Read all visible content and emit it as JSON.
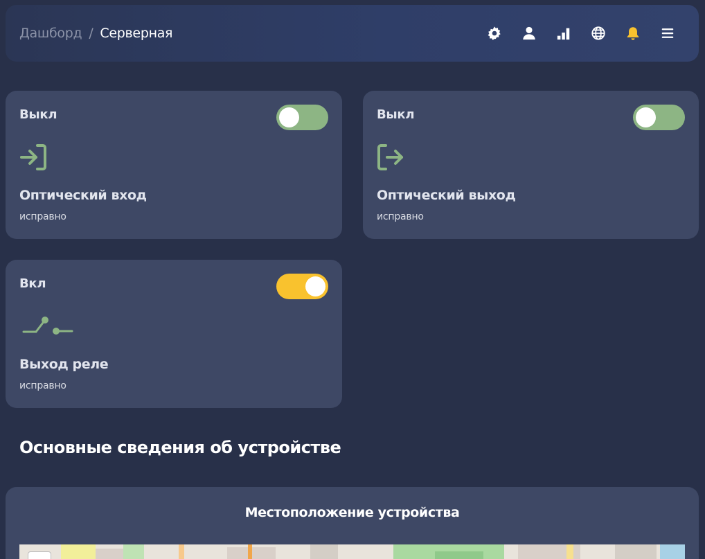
{
  "breadcrumb": {
    "home": "Дашборд",
    "separator": "/",
    "current": "Серверная"
  },
  "top_icons": [
    "settings-gear-icon",
    "user-icon",
    "signal-bars-icon",
    "globe-icon",
    "bell-icon",
    "menu-icon"
  ],
  "colors": {
    "accent_yellow": "#f9c22e",
    "toggle_green": "#8db584",
    "icon_green": "#8db584",
    "card_bg": "#3e4865",
    "page_bg": "#283049"
  },
  "cards": [
    {
      "state": "Выкл",
      "title": "Оптический вход",
      "status": "исправно",
      "toggle_on": false,
      "icon": "login-icon"
    },
    {
      "state": "Выкл",
      "title": "Оптический выход",
      "status": "исправно",
      "toggle_on": false,
      "icon": "logout-icon"
    },
    {
      "state": "Вкл",
      "title": "Выход реле",
      "status": "исправно",
      "toggle_on": true,
      "icon": "relay-switch-icon"
    }
  ],
  "section": {
    "title": "Основные сведения об устройстве"
  },
  "location": {
    "title": "Местоположение устройства"
  }
}
